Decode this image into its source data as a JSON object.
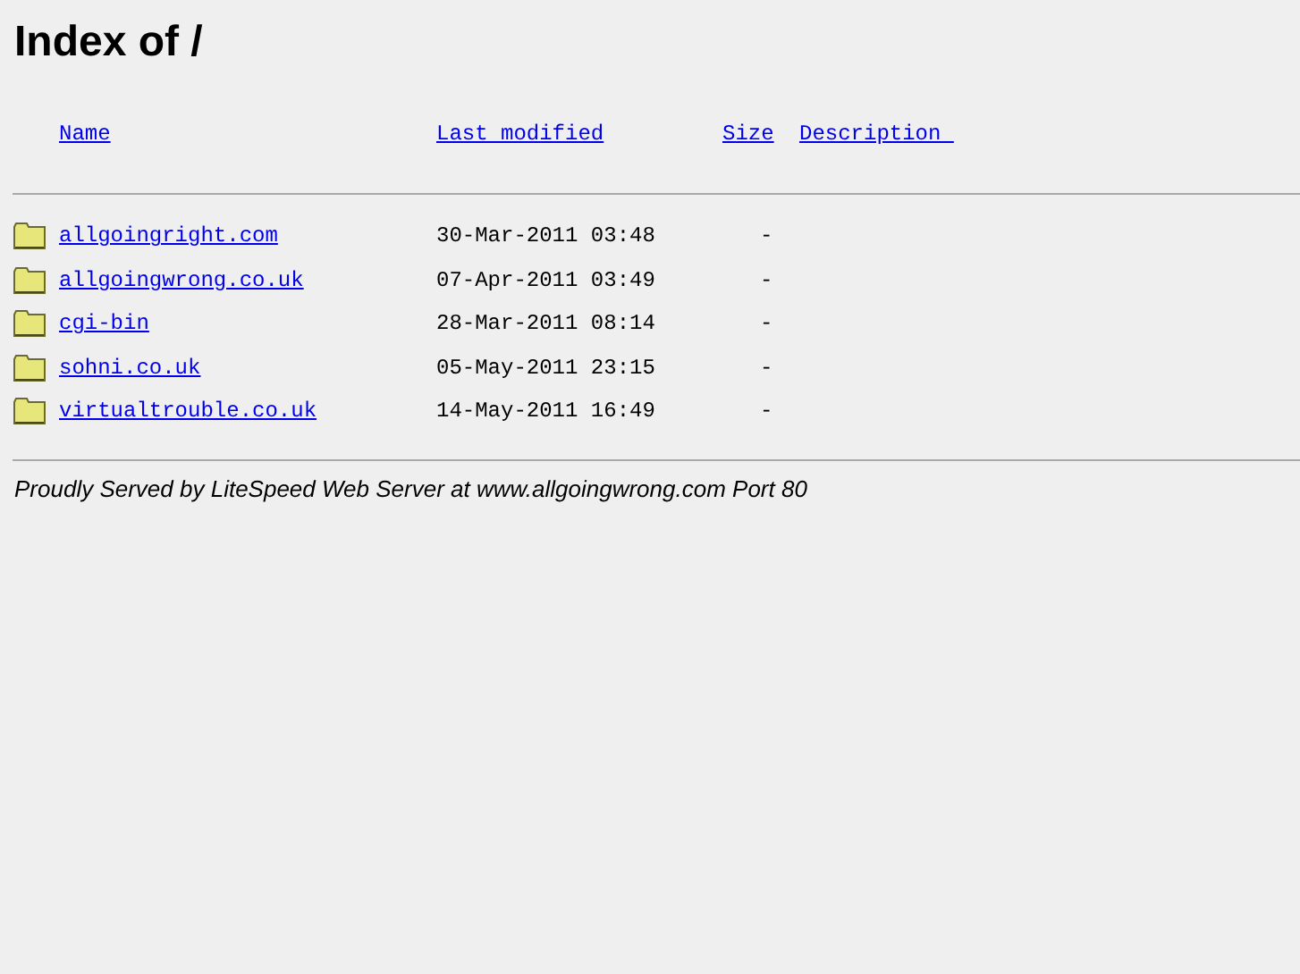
{
  "title": "Index of /",
  "columns": [
    "Name",
    "Last modified",
    "Size",
    "Description "
  ],
  "rows": [
    {
      "name": "allgoingright.com",
      "modified": "30-Mar-2011 03:48",
      "size": "-"
    },
    {
      "name": "allgoingwrong.co.uk",
      "modified": "07-Apr-2011 03:49",
      "size": "-"
    },
    {
      "name": "cgi-bin",
      "modified": "28-Mar-2011 08:14",
      "size": "-"
    },
    {
      "name": "sohni.co.uk",
      "modified": "05-May-2011 23:15",
      "size": "-"
    },
    {
      "name": "virtualtrouble.co.uk",
      "modified": "14-May-2011 16:49",
      "size": "-"
    }
  ],
  "footer": "Proudly Served by LiteSpeed Web Server at www.allgoingwrong.com Port 80"
}
